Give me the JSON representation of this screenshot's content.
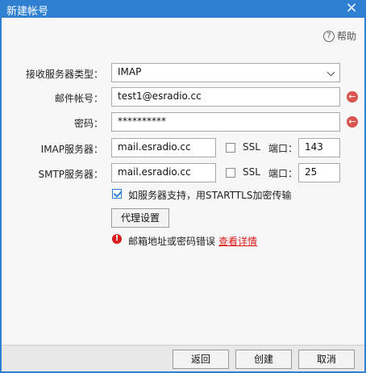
{
  "title": "新建帐号",
  "help": "帮助",
  "form": {
    "server_type_label": "接收服务器类型：",
    "server_type_value": "IMAP",
    "account_label": "邮件帐号：",
    "account_value": "test1@esradio.cc",
    "password_label": "密码：",
    "password_value": "**********",
    "imap_label": "IMAP服务器：",
    "imap_value": "mail.esradio.cc",
    "smtp_label": "SMTP服务器：",
    "smtp_value": "mail.esradio.cc",
    "ssl_label": "SSL",
    "port_label": "端口：",
    "imap_port": "143",
    "smtp_port": "25",
    "starttls_label": "如服务器支持，用STARTTLS加密传输",
    "proxy_button": "代理设置",
    "error_text": "邮箱地址或密码错误",
    "details_link": "查看详情"
  },
  "footer": {
    "back": "返回",
    "create": "创建",
    "cancel": "取消"
  }
}
